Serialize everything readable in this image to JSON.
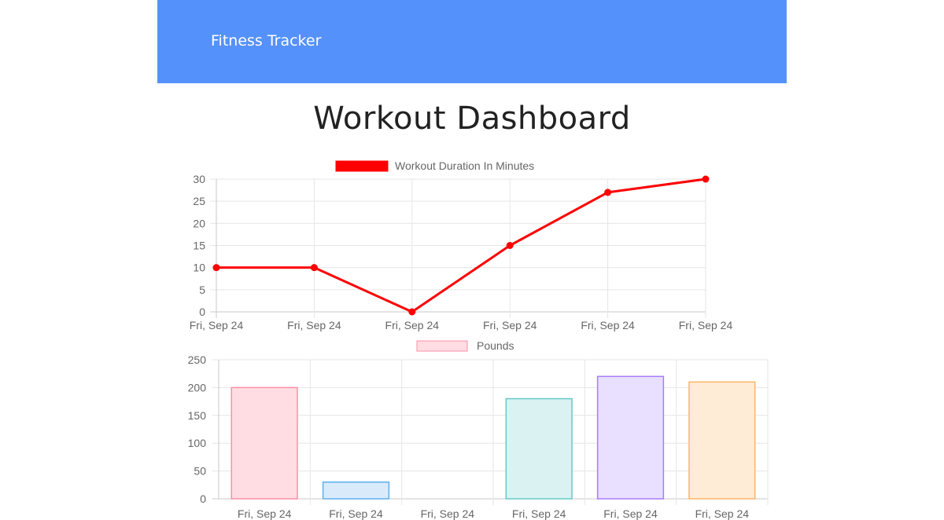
{
  "navbar": {
    "brand": "Fitness Tracker",
    "color": "#5591fb"
  },
  "page": {
    "title": "Workout Dashboard"
  },
  "chart_data": [
    {
      "type": "line",
      "categories": [
        "Fri, Sep 24",
        "Fri, Sep 24",
        "Fri, Sep 24",
        "Fri, Sep 24",
        "Fri, Sep 24",
        "Fri, Sep 24"
      ],
      "series": [
        {
          "name": "Workout Duration In Minutes",
          "values": [
            10,
            10,
            0,
            15,
            27,
            30
          ],
          "color": "#ff0000"
        }
      ],
      "ylim": [
        0,
        30
      ],
      "yticks": [
        0,
        5,
        10,
        15,
        20,
        25,
        30
      ],
      "grid": true,
      "legend": "top"
    },
    {
      "type": "bar",
      "categories": [
        "Fri, Sep 24",
        "Fri, Sep 24",
        "Fri, Sep 24",
        "Fri, Sep 24",
        "Fri, Sep 24",
        "Fri, Sep 24"
      ],
      "series": [
        {
          "name": "Pounds",
          "values": [
            200,
            30,
            0,
            180,
            220,
            210
          ]
        }
      ],
      "bar_fills": [
        "#ffdde3",
        "#d9ebfb",
        "#fff2d6",
        "#daf2f2",
        "#e9dffe",
        "#ffecd7"
      ],
      "bar_strokes": [
        "#ff8fa6",
        "#5eb0ee",
        "#ffc64f",
        "#66c9c9",
        "#a97cff",
        "#ffb466"
      ],
      "legend_fill": "#ffdde3",
      "legend_stroke": "#ff8fa6",
      "ylim": [
        0,
        250
      ],
      "yticks": [
        0,
        50,
        100,
        150,
        200,
        250
      ],
      "grid": true,
      "legend": "top"
    }
  ]
}
